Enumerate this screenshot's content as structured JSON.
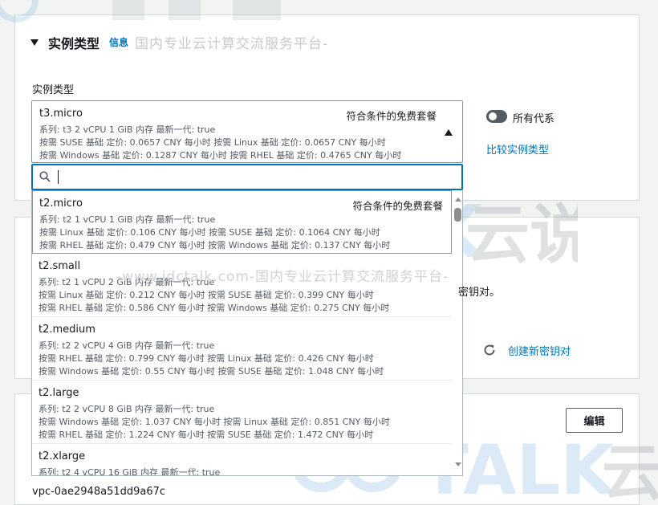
{
  "header": {
    "title": "实例类型",
    "info_link": "信息",
    "watermark": "国内专业云计算交流服务平台-"
  },
  "instance_type_field": {
    "label": "实例类型",
    "selected": {
      "name": "t3.micro",
      "tag": "符合条件的免费套餐",
      "line1": "系列: t3    2 vCPU    1 GiB 内存    最新一代: true",
      "line2": "按需 SUSE 基础 定价: 0.0657 CNY 每小时    按需 Linux 基础 定价: 0.0657 CNY 每小时",
      "line3": "按需 Windows 基础 定价: 0.1287 CNY 每小时    按需 RHEL 基础 定价: 0.4765 CNY 每小时"
    },
    "search": {
      "value": "",
      "placeholder": ""
    },
    "options": [
      {
        "name": "t2.micro",
        "tag": "符合条件的免费套餐",
        "line1": "系列: t2    1 vCPU    1 GiB 内存    最新一代: true",
        "line2": "按需 Linux 基础 定价: 0.106 CNY 每小时    按需 SUSE 基础 定价: 0.1064 CNY 每小时",
        "line3": "按需 RHEL 基础 定价: 0.479 CNY 每小时    按需 Windows 基础 定价: 0.137 CNY 每小时"
      },
      {
        "name": "t2.small",
        "tag": "",
        "line1": "系列: t2    1 vCPU    2 GiB 内存    最新一代: true",
        "line2": "按需 Linux 基础 定价: 0.212 CNY 每小时    按需 SUSE 基础 定价: 0.399 CNY 每小时",
        "line3": "按需 RHEL 基础 定价: 0.586 CNY 每小时    按需 Windows 基础 定价: 0.275 CNY 每小时"
      },
      {
        "name": "t2.medium",
        "tag": "",
        "line1": "系列: t2    2 vCPU    4 GiB 内存    最新一代: true",
        "line2": "按需 RHEL 基础 定价: 0.799 CNY 每小时    按需 Linux 基础 定价: 0.426 CNY 每小时",
        "line3": "按需 Windows 基础 定价: 0.55 CNY 每小时    按需 SUSE 基础 定价: 1.048 CNY 每小时"
      },
      {
        "name": "t2.large",
        "tag": "",
        "line1": "系列: t2    2 vCPU    8 GiB 内存    最新一代: true",
        "line2": "按需 Windows 基础 定价: 1.037 CNY 每小时    按需 Linux 基础 定价: 0.851 CNY 每小时",
        "line3": "按需 RHEL 基础 定价: 1.224 CNY 每小时    按需 SUSE 基础 定价: 1.472 CNY 每小时"
      },
      {
        "name": "t2.xlarge",
        "tag": "",
        "line1": "系列: t2    4 vCPU    16 GiB 内存    最新一代: true",
        "line2": "",
        "line3": ""
      }
    ]
  },
  "all_generations": {
    "label": "所有代系",
    "enabled": false
  },
  "compare_link": "比较实例类型",
  "key_pair": {
    "text_tail": "密钥对。",
    "create_link": "创建新密钥对"
  },
  "network": {
    "edit_button": "编辑",
    "vpc_id": "vpc-0ae2948a51dd9a67c"
  },
  "watermark_mid": "-www.idctalk.com-国内专业云计算交流服务平台-",
  "colors": {
    "link": "#0073bb",
    "border": "#879596",
    "focus": "#0073bb",
    "text": "#16191f",
    "secondary_text": "#545b64",
    "background": "#f2f3f3"
  }
}
